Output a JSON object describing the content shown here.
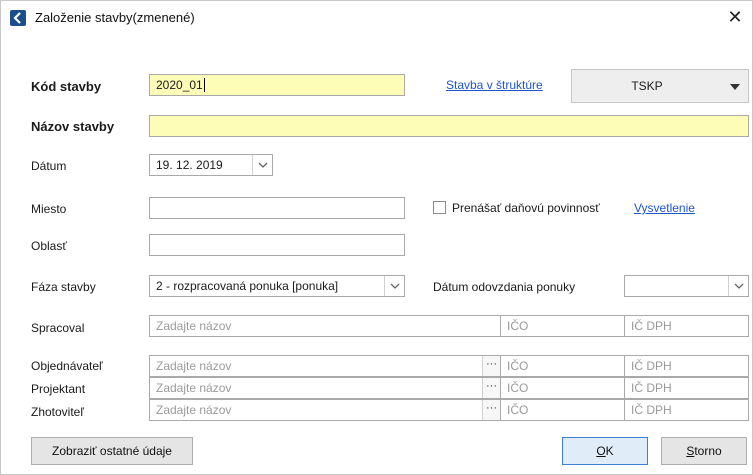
{
  "window": {
    "title": "Založenie stavby(zmenené)",
    "close_glyph": "✕"
  },
  "labels": {
    "kod_stavby": "Kód stavby",
    "nazov_stavby": "Názov stavby",
    "datum": "Dátum",
    "miesto": "Miesto",
    "oblast": "Oblasť",
    "faza_stavby": "Fáza stavby",
    "datum_odovzdania": "Dátum odovzdania ponuky",
    "spracoval": "Spracoval",
    "objednavatel": "Objednávateľ",
    "projektant": "Projektant",
    "zhotovitel": "Zhotoviteľ"
  },
  "fields": {
    "kod_stavby": "2020_01",
    "nazov_stavby": "",
    "datum": "19. 12. 2019",
    "miesto": "",
    "oblast": "",
    "faza_stavby": "2 - rozpracovaná ponuka [ponuka]",
    "datum_odovzdania": ""
  },
  "links": {
    "stavba_v_strukture": "Stavba v štruktúre",
    "vysvetlenie": "Vysvetlenie"
  },
  "tskp": {
    "label": "TSKP"
  },
  "checkbox": {
    "label": "Prenášať daňovú povinnosť",
    "checked": false
  },
  "placeholders": {
    "nazov": "Zadajte názov",
    "ico": "IČO",
    "ic_dph": "IČ DPH"
  },
  "ellipsis": "···",
  "buttons": {
    "zobrazit": "Zobraziť ostatné údaje",
    "ok": "OK",
    "storno_pre": "",
    "storno_key": "S",
    "storno_rest": "torno",
    "ok_key": "O",
    "ok_rest": "K"
  },
  "colors": {
    "required_bg": "#fefdb8",
    "link": "#1f56c7",
    "app_icon": "#1b4f8a"
  }
}
